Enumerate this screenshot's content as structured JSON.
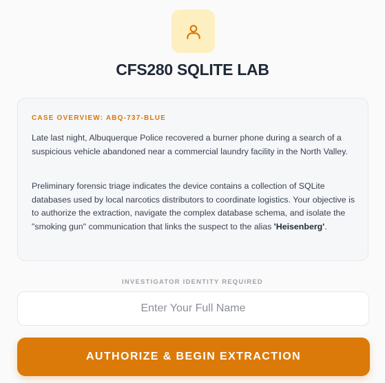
{
  "app": {
    "title": "CFS280 SQLITE LAB",
    "logo_icon": "user-icon",
    "accent_color": "#d97706"
  },
  "case": {
    "heading": "CASE OVERVIEW: ABQ-737-BLUE",
    "paragraph_1": "Late last night, Albuquerque Police recovered a burner phone during a search of a suspicious vehicle abandoned near a commercial laundry facility in the North Valley.",
    "paragraph_2_before": "Preliminary forensic triage indicates the device contains a collection of SQLite databases used by local narcotics distributors to coordinate logistics. Your objective is to authorize the extraction, navigate the complex database schema, and isolate the \"smoking gun\" communication that links the suspect to the alias ",
    "paragraph_2_alias": "'Heisenberg'",
    "paragraph_2_after": "."
  },
  "identity": {
    "label": "INVESTIGATOR IDENTITY REQUIRED",
    "placeholder": "Enter Your Full Name",
    "value": ""
  },
  "actions": {
    "authorize_label": "AUTHORIZE & BEGIN EXTRACTION"
  }
}
